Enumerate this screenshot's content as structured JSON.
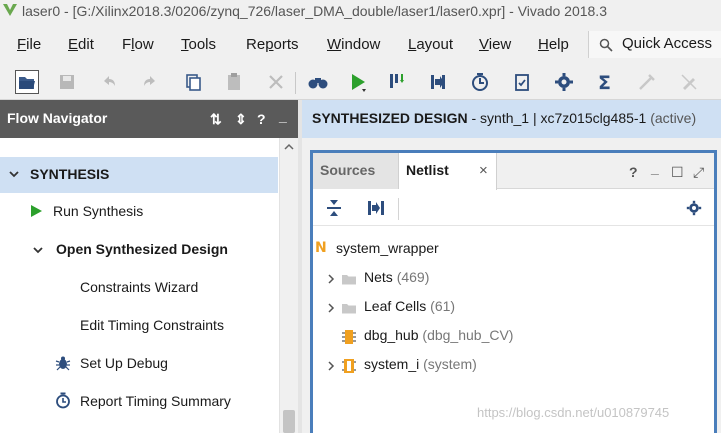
{
  "window": {
    "title": "laser0 - [G:/Xilinx2018.3/0206/zynq_726/laser_DMA_double/laser1/laser0.xpr] - Vivado 2018.3"
  },
  "menubar": {
    "items": [
      "File",
      "Edit",
      "Flow",
      "Tools",
      "Reports",
      "Window",
      "Layout",
      "View",
      "Help"
    ],
    "underlined": [
      "F",
      "E",
      "l",
      "T",
      "p",
      "W",
      "L",
      "V",
      "H"
    ],
    "quick_access": "Quick Access"
  },
  "toolbar": {
    "icons": [
      "open-project-icon",
      "save-icon",
      "undo-icon",
      "redo-icon",
      "copy-icon",
      "paste-icon",
      "delete-icon",
      "find-icon",
      "run-icon",
      "program-icon",
      "step-icon",
      "timer-icon",
      "checklist-icon",
      "settings-icon",
      "sigma-icon",
      "disabled-pin-icon",
      "disabled-edit-icon"
    ]
  },
  "flow_navigator": {
    "title": "Flow Navigator",
    "header_controls": [
      "⇅",
      "⇕",
      "?",
      "_"
    ],
    "section": "SYNTHESIS",
    "items": [
      {
        "label": "Run Synthesis",
        "icon": "run-icon"
      },
      {
        "label": "Open Synthesized Design",
        "icon": "chevron-down-icon"
      },
      {
        "label": "Constraints Wizard",
        "icon": ""
      },
      {
        "label": "Edit Timing Constraints",
        "icon": ""
      },
      {
        "label": "Set Up Debug",
        "icon": "bug-icon"
      },
      {
        "label": "Report Timing Summary",
        "icon": "clock-icon"
      }
    ]
  },
  "design_header": {
    "title": "SYNTHESIZED DESIGN",
    "detail": " - synth_1 | xc7z015clg485-1 ",
    "status": "(active)"
  },
  "panel": {
    "tabs": [
      {
        "label": "Sources",
        "active": false
      },
      {
        "label": "Netlist",
        "active": true
      }
    ],
    "close_glyph": "×",
    "controls": [
      "?",
      "_",
      "☐",
      "⤢"
    ],
    "tree": {
      "root": {
        "label": "system_wrapper",
        "icon": "n-icon"
      },
      "children": [
        {
          "name": "Nets",
          "count": "(469)",
          "expandable": true,
          "icon": "folder-icon"
        },
        {
          "name": "Leaf Cells",
          "count": "(61)",
          "expandable": true,
          "icon": "folder-icon"
        },
        {
          "name": "dbg_hub",
          "count": "(dbg_hub_CV)",
          "expandable": false,
          "icon": "cell-icon"
        },
        {
          "name": "system_i",
          "count": "(system)",
          "expandable": true,
          "icon": "cell-icon"
        }
      ]
    }
  },
  "watermark": "https://blog.csdn.net/u010879745",
  "colors": {
    "accent_blue": "#4a7ebb",
    "selection": "#cfe0f3",
    "header_dark": "#5a5a5a",
    "run_green": "#2ca02c"
  }
}
